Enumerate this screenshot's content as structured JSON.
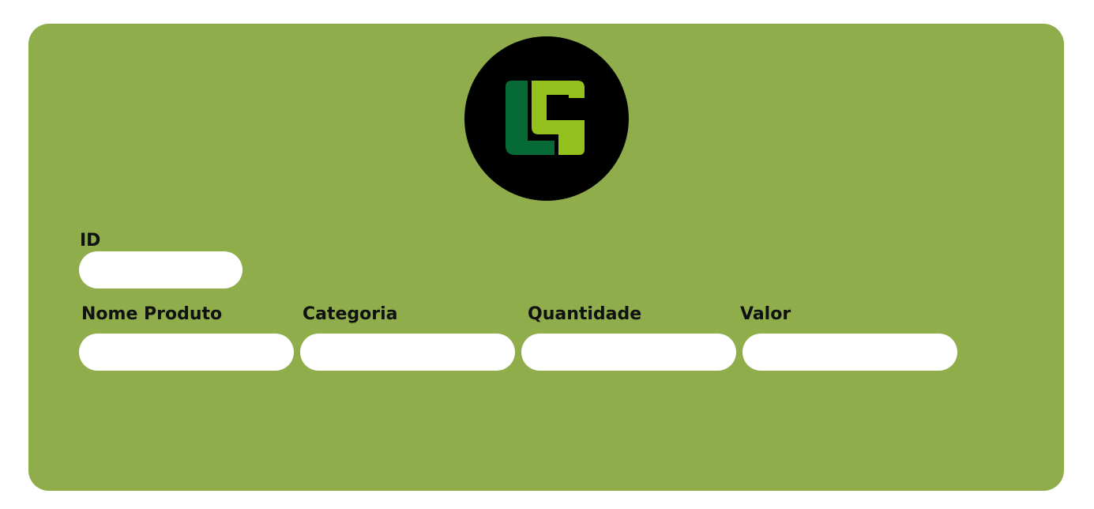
{
  "logo": {
    "icon": "lg-monogram-icon",
    "colors": {
      "background": "#000000",
      "dark_green": "#066a36",
      "light_green": "#95c11f"
    }
  },
  "form": {
    "id": {
      "label": "ID",
      "value": ""
    },
    "nome_produto": {
      "label": "Nome Produto",
      "value": ""
    },
    "categoria": {
      "label": "Categoria",
      "value": ""
    },
    "quantidade": {
      "label": "Quantidade",
      "value": ""
    },
    "valor": {
      "label": "Valor",
      "value": ""
    }
  },
  "theme": {
    "panel_color": "#8fad4a",
    "page_background": "#ffffff",
    "field_color": "#ffffff"
  }
}
